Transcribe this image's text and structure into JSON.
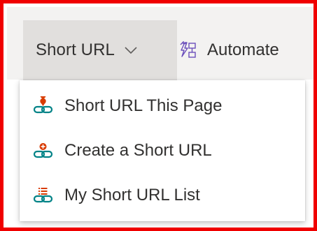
{
  "toolbar": {
    "menu_button": {
      "label": "Short URL",
      "icon": "chevron-down-icon"
    },
    "automate_button": {
      "label": "Automate",
      "icon": "flow-icon"
    }
  },
  "dropdown": {
    "items": [
      {
        "label": "Short URL This Page",
        "icon": "link-pin-icon"
      },
      {
        "label": "Create a Short URL",
        "icon": "link-plus-icon"
      },
      {
        "label": "My Short URL List",
        "icon": "link-list-icon"
      }
    ]
  },
  "colors": {
    "highlight_border": "#f00000",
    "toolbar_bg": "#f3f2f1",
    "menu_trigger_bg": "#e1dfdd",
    "text": "#323130",
    "icon_teal": "#038387",
    "icon_red": "#d83b01",
    "automate_icon": "#6b4fbb"
  }
}
